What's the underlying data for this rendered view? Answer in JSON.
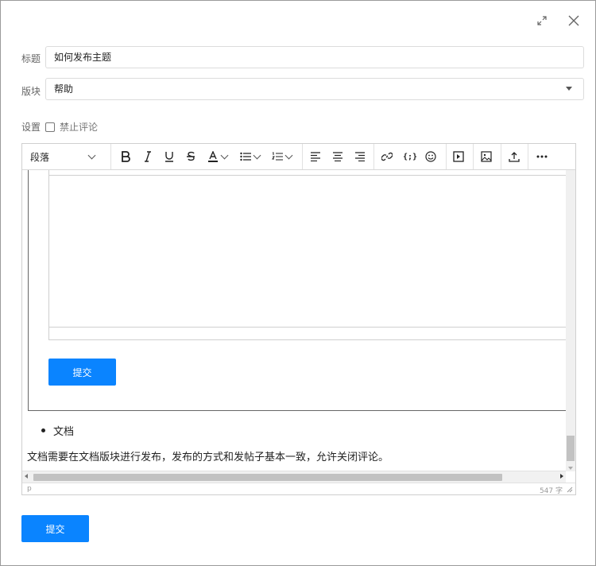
{
  "form": {
    "title_label": "标题",
    "title_value": "如何发布主题",
    "section_label": "版块",
    "section_value": "帮助",
    "settings_label": "设置",
    "disable_comments_label": "禁止评论"
  },
  "toolbar": {
    "paragraph_label": "段落",
    "icons": [
      "bold-icon",
      "italic-icon",
      "underline-icon",
      "strikethrough-icon",
      "text-color-icon",
      "bullet-list-icon",
      "numbered-list-icon",
      "align-left-icon",
      "align-center-icon",
      "align-right-icon",
      "link-icon",
      "code-icon",
      "emoji-icon",
      "video-icon",
      "image-icon",
      "upload-icon",
      "more-icon"
    ]
  },
  "content": {
    "inner_submit_label": "提交",
    "list_item": "文档",
    "paragraph": "文档需要在文档版块进行发布，发布的方式和发帖子基本一致，允许关闭评论。"
  },
  "statusbar": {
    "element_path": "p",
    "word_count": "547 字"
  },
  "footer": {
    "submit_label": "提交"
  },
  "colors": {
    "accent": "#0a84ff"
  }
}
